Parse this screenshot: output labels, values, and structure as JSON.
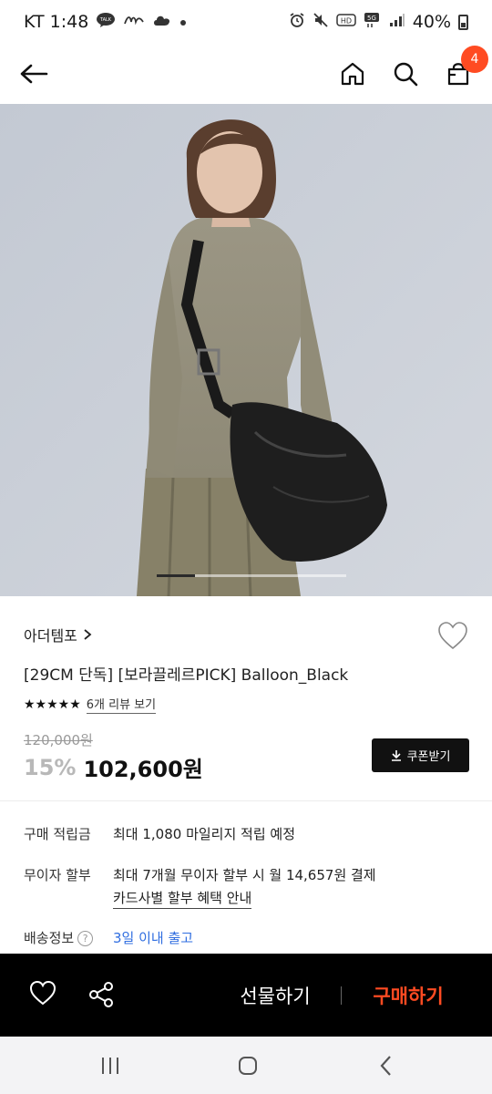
{
  "status_bar": {
    "carrier_time": "KT 1:48",
    "battery": "40%",
    "network": "5G"
  },
  "header": {
    "back_icon": "arrow-left-icon",
    "home_icon": "home-icon",
    "search_icon": "search-icon",
    "cart_icon": "shopping-bag-icon",
    "cart_count": "4",
    "badge_color": "#ff4b22"
  },
  "gallery": {
    "current_index": 1,
    "image_count": 5
  },
  "product": {
    "brand": "아더템포",
    "title": "[29CM 단독] [보라끌레르PICK] Balloon_Black",
    "rating_stars": "★★★★★",
    "review_link": "6개 리뷰 보기",
    "original_price": "120,000원",
    "discount": "15%",
    "sale_price": "102,600원",
    "coupon_label": "쿠폰받기"
  },
  "info": {
    "mileage_label": "구매 적립금",
    "mileage_value": "최대 1,080 마일리지 적립 예정",
    "installment_label": "무이자 할부",
    "installment_value": "최대 7개월 무이자 할부 시 월 14,657원 결제",
    "installment_link": "카드사별 할부 혜택 안내",
    "shipping_label": "배송정보",
    "shipping_help": "?",
    "shipping_value": "3일 이내 출고",
    "shipping_color": "#2f6de0"
  },
  "buy_bar": {
    "gift_label": "선물하기",
    "buy_label": "구매하기",
    "buy_color": "#ff4b22"
  }
}
